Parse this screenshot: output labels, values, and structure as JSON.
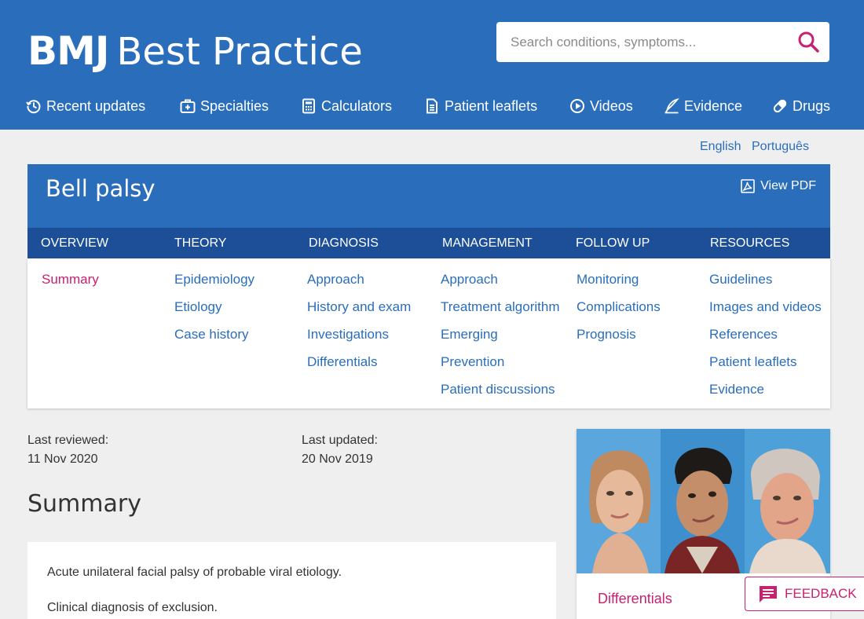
{
  "header": {
    "logo_bmj": "BMJ",
    "logo_rest": "Best Practice",
    "search_placeholder": "Search conditions, symptoms..."
  },
  "nav": {
    "items": [
      {
        "label": "Recent updates",
        "icon": "clock-history-icon"
      },
      {
        "label": "Specialties",
        "icon": "medical-bag-icon"
      },
      {
        "label": "Calculators",
        "icon": "calculator-icon"
      },
      {
        "label": "Patient leaflets",
        "icon": "document-icon"
      },
      {
        "label": "Videos",
        "icon": "play-circle-icon"
      },
      {
        "label": "Evidence",
        "icon": "quill-icon"
      },
      {
        "label": "Drugs",
        "icon": "pill-icon"
      }
    ]
  },
  "languages": [
    "English",
    "Português"
  ],
  "topic": {
    "title": "Bell palsy",
    "view_pdf": "View PDF"
  },
  "tabs": [
    {
      "label": "OVERVIEW",
      "links": [
        "Summary"
      ]
    },
    {
      "label": "THEORY",
      "links": [
        "Epidemiology",
        "Etiology",
        "Case history"
      ]
    },
    {
      "label": "DIAGNOSIS",
      "links": [
        "Approach",
        "History and exam",
        "Investigations",
        "Differentials"
      ]
    },
    {
      "label": "MANAGEMENT",
      "links": [
        "Approach",
        "Treatment algorithm",
        "Emerging",
        "Prevention",
        "Patient discussions"
      ]
    },
    {
      "label": "FOLLOW UP",
      "links": [
        "Monitoring",
        "Complications",
        "Prognosis"
      ]
    },
    {
      "label": "RESOURCES",
      "links": [
        "Guidelines",
        "Images and videos",
        "References",
        "Patient leaflets",
        "Evidence"
      ]
    }
  ],
  "meta": {
    "last_reviewed_label": "Last reviewed:",
    "last_reviewed_date": "11 Nov 2020",
    "last_updated_label": "Last updated:",
    "last_updated_date": "20 Nov 2019"
  },
  "summary": {
    "title": "Summary",
    "points": [
      "Acute unilateral facial palsy of probable viral etiology.",
      "Clinical diagnosis of exclusion."
    ]
  },
  "image_card": {
    "caption": "Differentials"
  },
  "feedback": {
    "label": "FEEDBACK"
  },
  "colors": {
    "brand_blue": "#2a6ebb",
    "tab_bar": "#1d4f99",
    "accent_magenta": "#c6226f",
    "background": "#efefef"
  }
}
